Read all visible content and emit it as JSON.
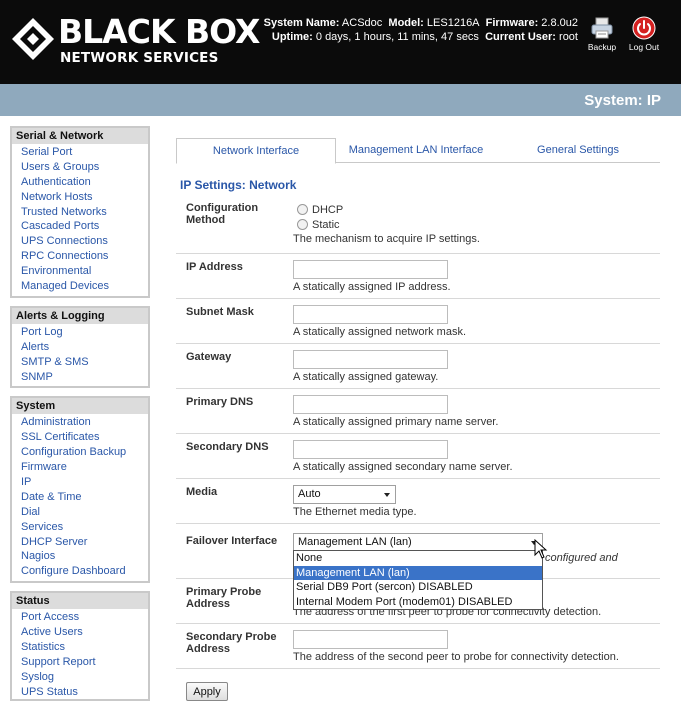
{
  "brand": {
    "name": "BLACK BOX",
    "subtitle": "NETWORK SERVICES",
    "logo_icon": "diamond-logo-icon"
  },
  "system_info": {
    "line1": [
      {
        "label": "System Name:",
        "value": "ACSdoc"
      },
      {
        "label": "Model:",
        "value": "LES1216A"
      },
      {
        "label": "Firmware:",
        "value": "2.8.0u2"
      }
    ],
    "line2": [
      {
        "label": "Uptime:",
        "value": "0 days, 1 hours, 11 mins, 47 secs"
      },
      {
        "label": "Current User:",
        "value": "root"
      }
    ]
  },
  "header_buttons": {
    "backup": {
      "label": "Backup",
      "icon": "printer-icon"
    },
    "logout": {
      "label": "Log Out",
      "icon": "power-icon"
    }
  },
  "page_title": "System: IP",
  "colors": {
    "header_bg": "#0b0b0b",
    "title_band": "#8fa9bd",
    "link": "#2a57a8",
    "highlight": "#3a73c8"
  },
  "sidebar": {
    "serial": {
      "title": "Serial & Network",
      "items": [
        "Serial Port",
        "Users & Groups",
        "Authentication",
        "Network Hosts",
        "Trusted Networks",
        "Cascaded Ports",
        "UPS Connections",
        "RPC Connections",
        "Environmental",
        "Managed Devices"
      ]
    },
    "alerts": {
      "title": "Alerts & Logging",
      "items": [
        "Port Log",
        "Alerts",
        "SMTP & SMS",
        "SNMP"
      ]
    },
    "system": {
      "title": "System",
      "items": [
        "Administration",
        "SSL Certificates",
        "Configuration Backup",
        "Firmware",
        "IP",
        "Date & Time",
        "Dial",
        "Services",
        "DHCP Server",
        "Nagios",
        "Configure Dashboard"
      ]
    },
    "status": {
      "title": "Status",
      "items": [
        "Port Access",
        "Active Users",
        "Statistics",
        "Support Report",
        "Syslog",
        "UPS Status"
      ]
    }
  },
  "tabs": [
    {
      "label": "Network Interface",
      "active": true
    },
    {
      "label": "Management LAN Interface",
      "active": false
    },
    {
      "label": "General Settings",
      "active": false
    }
  ],
  "section_title": "IP Settings: Network",
  "form": {
    "config_method": {
      "label": "Configuration Method",
      "options": [
        "DHCP",
        "Static"
      ],
      "help": "The mechanism to acquire IP settings."
    },
    "ip_address": {
      "label": "IP Address",
      "value": "",
      "help": "A statically assigned IP address."
    },
    "subnet_mask": {
      "label": "Subnet Mask",
      "value": "",
      "help": "A statically assigned network mask."
    },
    "gateway": {
      "label": "Gateway",
      "value": "",
      "help": "A statically assigned gateway."
    },
    "primary_dns": {
      "label": "Primary DNS",
      "value": "",
      "help": "A statically assigned primary name server."
    },
    "secondary_dns": {
      "label": "Secondary DNS",
      "value": "",
      "help": "A statically assigned secondary name server."
    },
    "media": {
      "label": "Media",
      "value": "Auto",
      "help": "The Ethernet media type."
    },
    "failover": {
      "label": "Failover Interface",
      "value": "Management LAN (lan)",
      "help_fragment": "configured and",
      "options": [
        "None",
        "Management LAN (lan)",
        "Serial DB9 Port (sercon) DISABLED",
        "Internal Modem Port (modem01) DISABLED"
      ],
      "highlighted": "Management LAN (lan)"
    },
    "primary_probe": {
      "label": "Primary Probe Address",
      "value": "",
      "help": "The address of the first peer to probe for connectivity detection."
    },
    "secondary_probe": {
      "label": "Secondary Probe Address",
      "value": "",
      "help": "The address of the second peer to probe for connectivity detection."
    }
  },
  "apply_label": "Apply"
}
